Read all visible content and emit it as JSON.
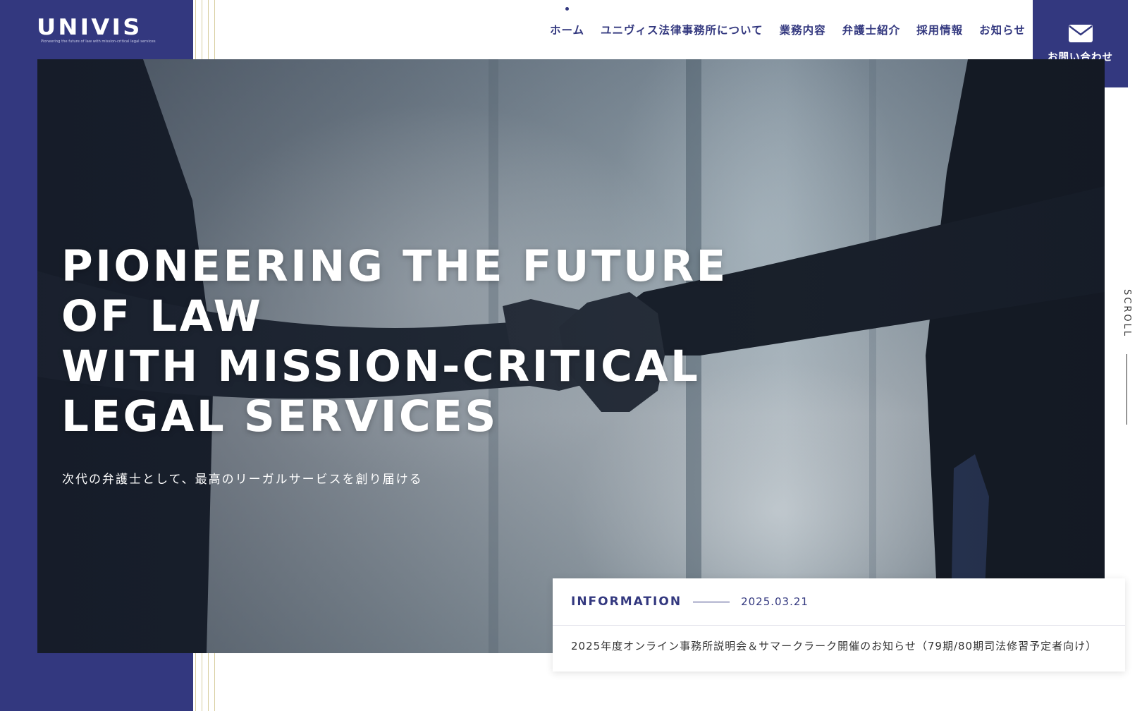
{
  "brand": {
    "logo_text": "UNIVIS",
    "tagline": "Pioneering the future of law with mission-critical legal services"
  },
  "nav": {
    "items": [
      {
        "label": "ホーム",
        "active": true
      },
      {
        "label": "ユニヴィス法律事務所について"
      },
      {
        "label": "業務内容"
      },
      {
        "label": "弁護士紹介"
      },
      {
        "label": "採用情報"
      },
      {
        "label": "お知らせ"
      }
    ]
  },
  "contact": {
    "label": "お問い合わせ",
    "icon": "mail-icon"
  },
  "hero": {
    "headline_lines": [
      "PIONEERING THE FUTURE",
      "OF LAW",
      "WITH MISSION-CRITICAL",
      "LEGAL SERVICES"
    ],
    "subtitle": "次代の弁護士として、最高のリーガルサービスを創り届ける"
  },
  "scroll": {
    "label": "SCROLL"
  },
  "information": {
    "title": "INFORMATION",
    "date": "2025.03.21",
    "text": "2025年度オンライン事務所説明会＆サマークラーク開催のお知らせ（79期/80期司法修習予定者向け）"
  },
  "colors": {
    "brand_navy": "#33387f",
    "gold_line": "#d7cd9e"
  }
}
